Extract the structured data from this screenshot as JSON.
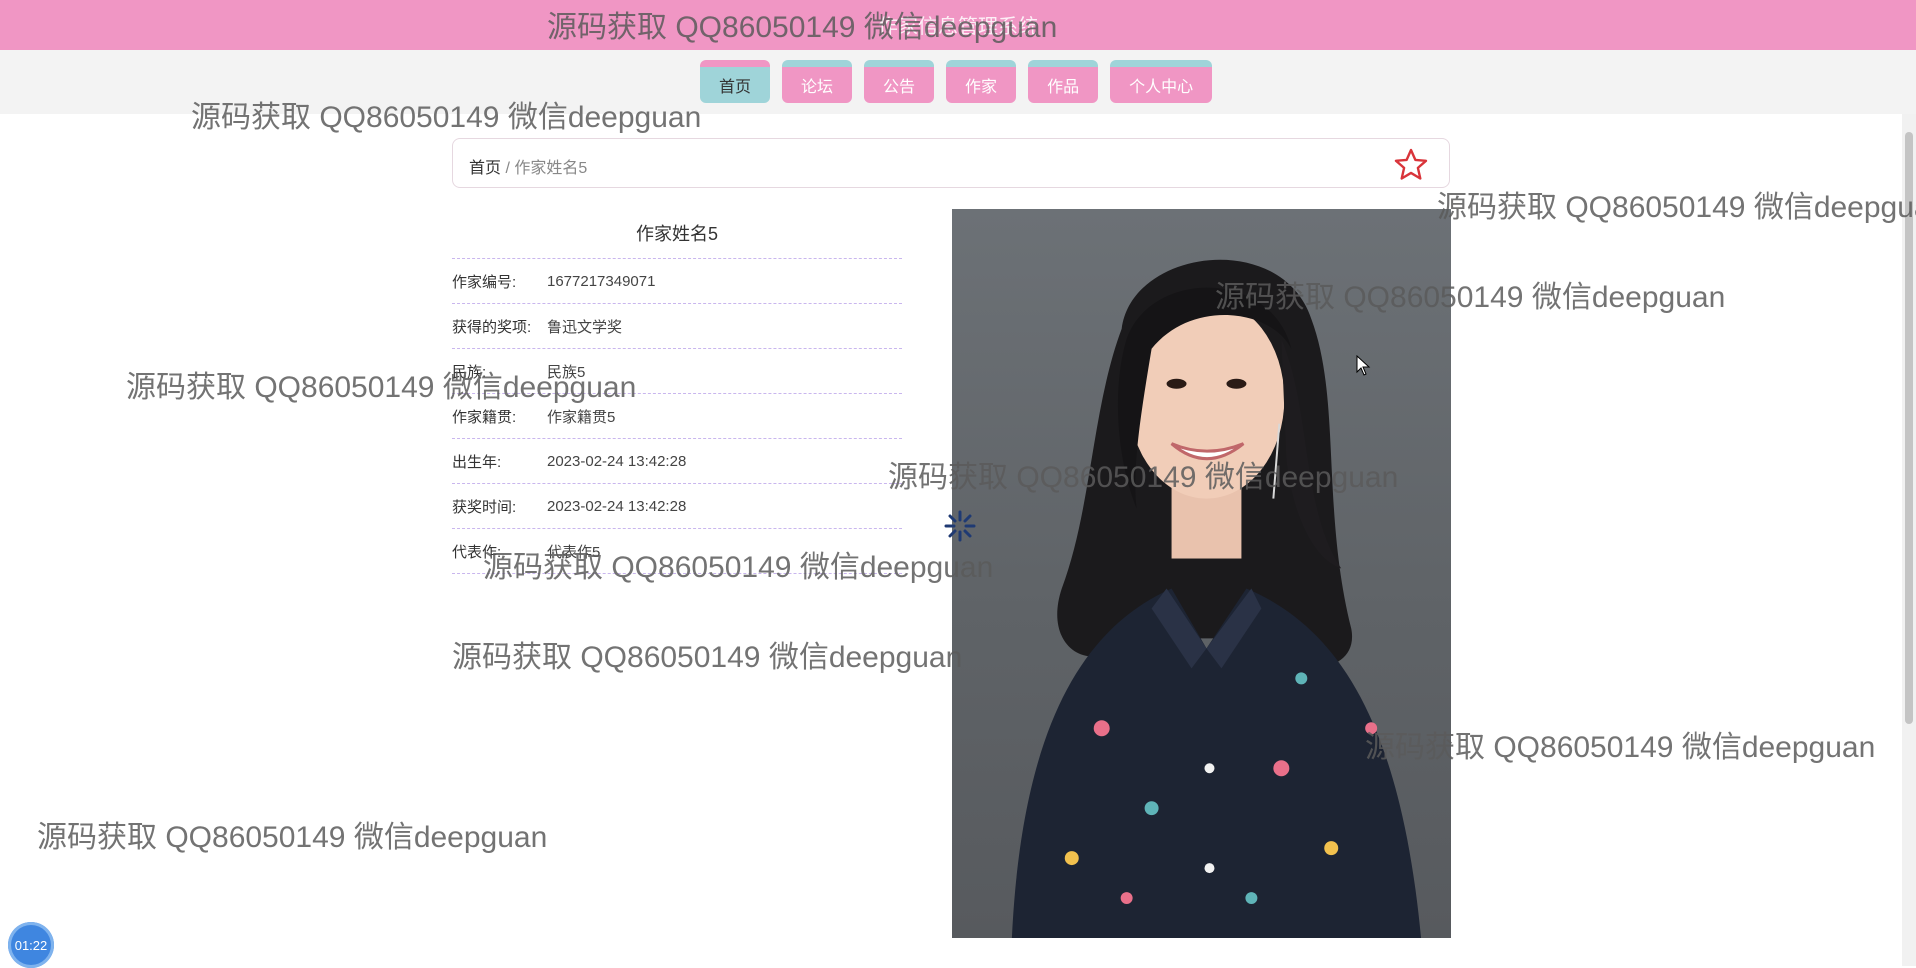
{
  "header": {
    "site_title": "作家信息管理系统"
  },
  "nav": {
    "items": [
      {
        "label": "首页",
        "active": true
      },
      {
        "label": "论坛"
      },
      {
        "label": "公告"
      },
      {
        "label": "作家"
      },
      {
        "label": "作品"
      },
      {
        "label": "个人中心"
      }
    ]
  },
  "breadcrumb": {
    "home": "首页",
    "separator": "/",
    "current": "作家姓名5"
  },
  "favorite_icon": "star-outline-icon",
  "author": {
    "name": "作家姓名5",
    "fields": [
      {
        "label": "作家编号:",
        "value": "1677217349071"
      },
      {
        "label": "获得的奖项:",
        "value": "鲁迅文学奖"
      },
      {
        "label": "民族:",
        "value": "民族5"
      },
      {
        "label": "作家籍贯:",
        "value": "作家籍贯5"
      },
      {
        "label": "出生年:",
        "value": "2023-02-24 13:42:28"
      },
      {
        "label": "获奖时间:",
        "value": "2023-02-24 13:42:28"
      },
      {
        "label": "代表作:",
        "value": "代表作5"
      }
    ]
  },
  "timer": {
    "value": "01:22"
  },
  "watermark_text": "源码获取 QQ86050149 微信deepguan",
  "colors": {
    "header_pink": "#f096c4",
    "nav_teal": "#9fd4d9",
    "star_red": "#d9343a"
  }
}
